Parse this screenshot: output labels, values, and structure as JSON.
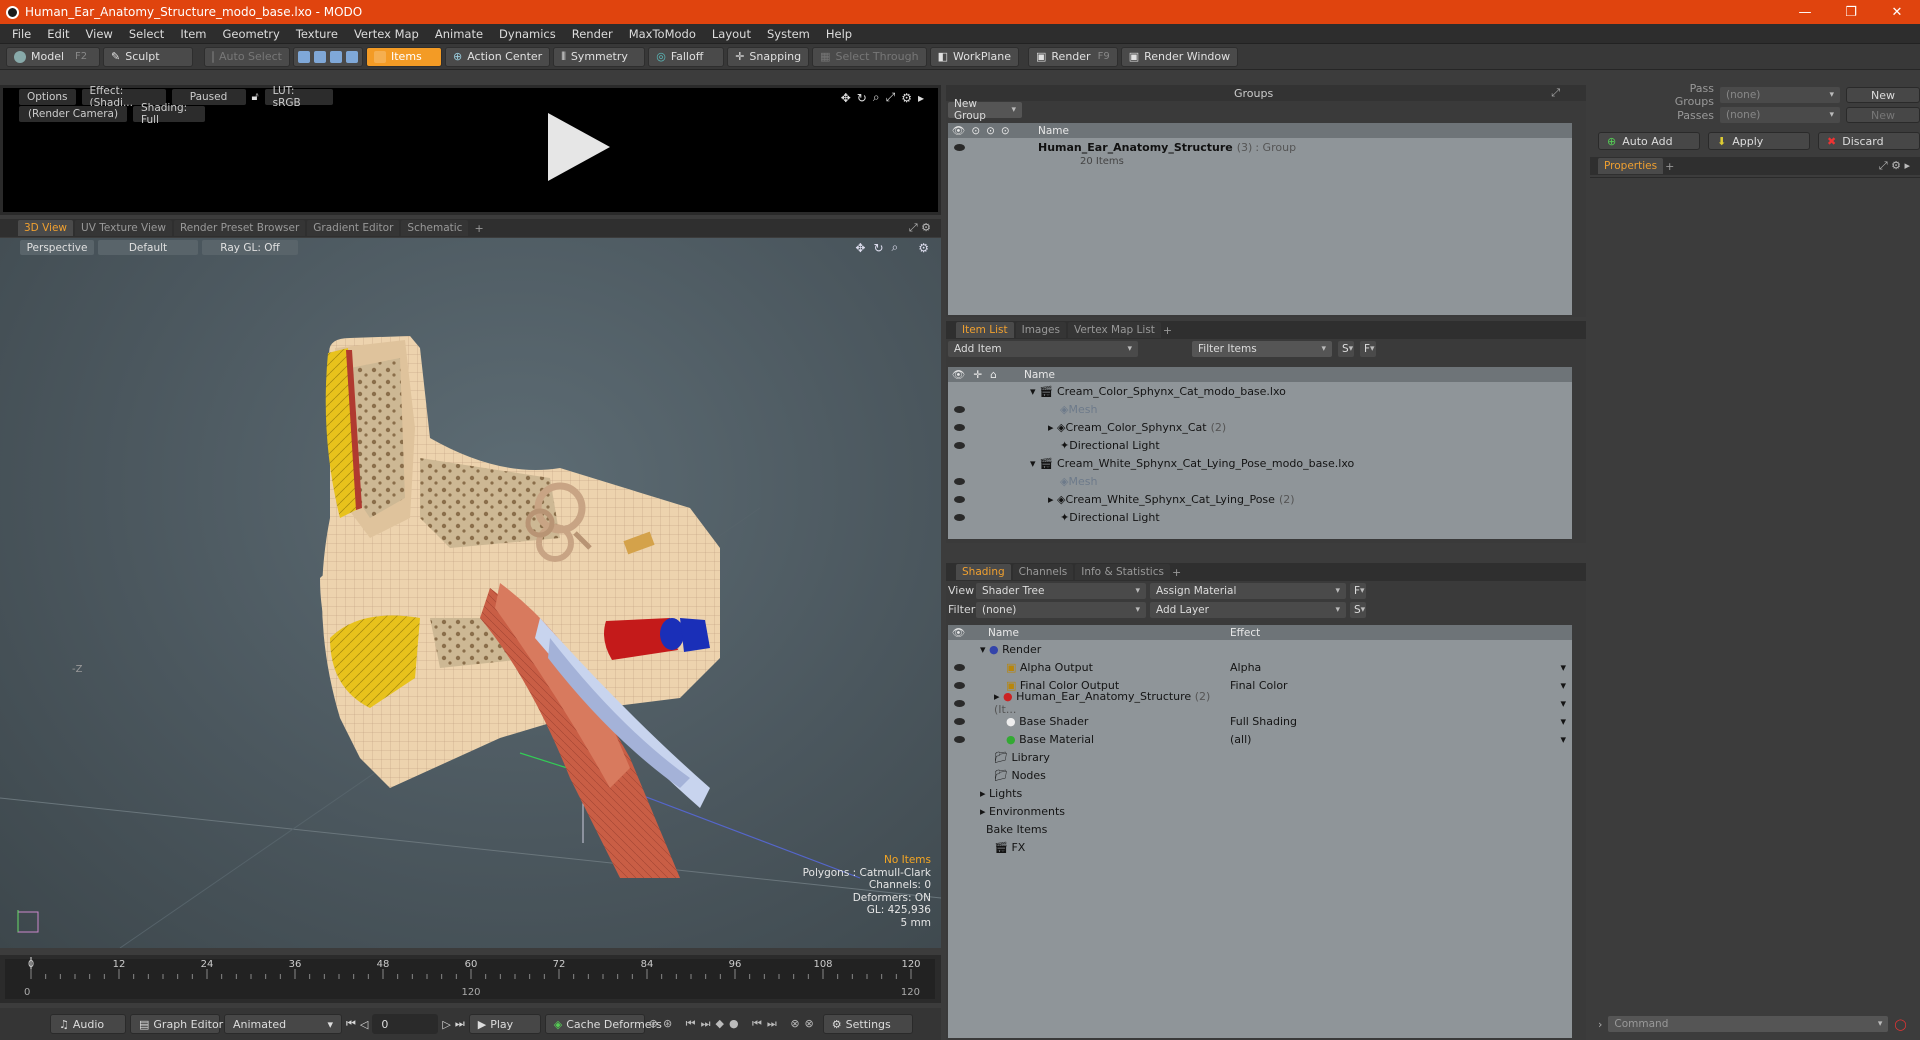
{
  "window": {
    "title": "Human_Ear_Anatomy_Structure_modo_base.lxo - MODO",
    "controls": [
      "—",
      "❐",
      "✕"
    ]
  },
  "menu": [
    "File",
    "Edit",
    "View",
    "Select",
    "Item",
    "Geometry",
    "Texture",
    "Vertex Map",
    "Animate",
    "Dynamics",
    "Render",
    "MaxToModo",
    "Layout",
    "System",
    "Help"
  ],
  "toolbar": {
    "model": "Model",
    "model_key": "F2",
    "sculpt": "Sculpt",
    "auto_select": "Auto Select",
    "items": "Items",
    "action_center": "Action Center",
    "symmetry": "Symmetry",
    "falloff": "Falloff",
    "snapping": "Snapping",
    "select_through": "Select Through",
    "workplane": "WorkPlane",
    "render": "Render",
    "render_key": "F9",
    "render_window": "Render Window"
  },
  "preview": {
    "options": "Options",
    "effect": "Effect: (Shadi...",
    "paused": "Paused",
    "lut": "LUT: sRGB",
    "camera": "(Render Camera)",
    "shading": "Shading: Full"
  },
  "view_tabs": [
    "3D View",
    "UV Texture View",
    "Render Preset Browser",
    "Gradient Editor",
    "Schematic"
  ],
  "viewport": {
    "perspective": "Perspective",
    "default": "Default",
    "raygl": "Ray GL: Off",
    "axis_label": "-Z",
    "stats": {
      "no_items": "No Items",
      "polygons": "Polygons : Catmull-Clark",
      "channels": "Channels: 0",
      "deformers": "Deformers: ON",
      "gl": "GL: 425,936",
      "scale": "5 mm"
    }
  },
  "timeline": {
    "ticks": [
      "0",
      "12",
      "24",
      "36",
      "48",
      "60",
      "72",
      "84",
      "96",
      "108",
      "120"
    ],
    "range_start": "0",
    "range_mid": "120",
    "range_end": "120"
  },
  "transport": {
    "audio": "Audio",
    "graph_editor": "Graph Editor",
    "animated": "Animated",
    "frame": "0",
    "play": "Play",
    "cache_deformers": "Cache Deformers",
    "settings": "Settings"
  },
  "groups": {
    "title": "Groups",
    "new_group": "New Group",
    "col_name": "Name",
    "item_name": "Human_Ear_Anatomy_Structure",
    "item_count": "(3)",
    "item_type": ": Group",
    "item_sub": "20 Items"
  },
  "itemlist": {
    "tabs": [
      "Item List",
      "Images",
      "Vertex Map List"
    ],
    "add_item": "Add Item",
    "filter": "Filter Items",
    "s": "S",
    "f": "F",
    "col_name": "Name",
    "rows": [
      {
        "label": "Cream_Color_Sphynx_Cat_modo_base.lxo",
        "count": ""
      },
      {
        "label": "Mesh",
        "count": ""
      },
      {
        "label": "Cream_Color_Sphynx_Cat",
        "count": "(2)"
      },
      {
        "label": "Directional Light",
        "count": ""
      },
      {
        "label": "Cream_White_Sphynx_Cat_Lying_Pose_modo_base.lxo",
        "count": ""
      },
      {
        "label": "Mesh",
        "count": ""
      },
      {
        "label": "Cream_White_Sphynx_Cat_Lying_Pose",
        "count": "(2)"
      },
      {
        "label": "Directional Light",
        "count": ""
      }
    ]
  },
  "shading": {
    "tabs": [
      "Shading",
      "Channels",
      "Info & Statistics"
    ],
    "view_label": "View",
    "view_value": "Shader Tree",
    "assign": "Assign Material",
    "f": "F",
    "filter_label": "Filter",
    "filter_value": "(none)",
    "add_layer": "Add Layer",
    "s": "S",
    "col_name": "Name",
    "col_effect": "Effect",
    "rows": [
      {
        "label": "Render",
        "effect": ""
      },
      {
        "label": "Alpha Output",
        "effect": "Alpha"
      },
      {
        "label": "Final Color Output",
        "effect": "Final Color"
      },
      {
        "label": "Human_Ear_Anatomy_Structure",
        "count": "(2) (It...",
        "effect": ""
      },
      {
        "label": "Base Shader",
        "effect": "Full Shading"
      },
      {
        "label": "Base Material",
        "effect": "(all)"
      },
      {
        "label": "Library",
        "effect": ""
      },
      {
        "label": "Nodes",
        "effect": ""
      },
      {
        "label": "Lights",
        "effect": ""
      },
      {
        "label": "Environments",
        "effect": ""
      },
      {
        "label": "Bake Items",
        "effect": ""
      },
      {
        "label": "FX",
        "effect": ""
      }
    ]
  },
  "right": {
    "pass_groups": "Pass Groups",
    "passes": "Passes",
    "none": "(none)",
    "new": "New",
    "auto_add": "Auto Add",
    "apply": "Apply",
    "discard": "Discard",
    "properties": "Properties",
    "command": "Command"
  }
}
